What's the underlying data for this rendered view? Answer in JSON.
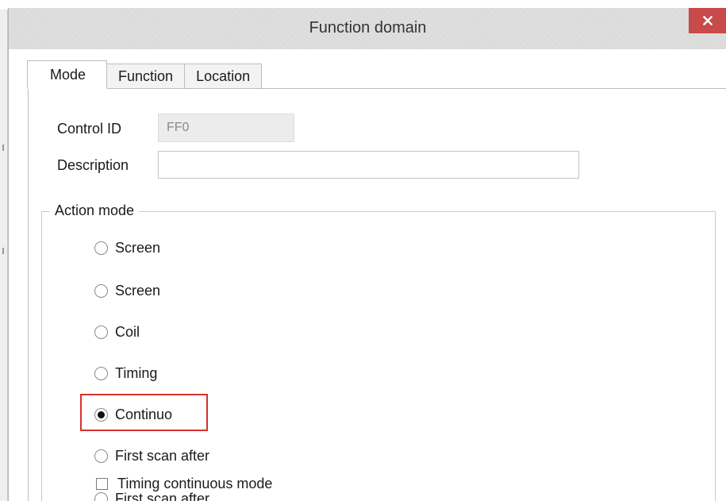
{
  "dialog": {
    "title": "Function domain",
    "close_icon": "close-icon"
  },
  "tabs": [
    {
      "label": "Mode",
      "active": true
    },
    {
      "label": "Function",
      "active": false
    },
    {
      "label": "Location",
      "active": false
    }
  ],
  "form": {
    "control_id_label": "Control ID",
    "control_id_value": "FF0",
    "description_label": "Description",
    "description_value": ""
  },
  "action_mode": {
    "legend": "Action mode",
    "options": [
      {
        "label": "Screen",
        "selected": false
      },
      {
        "label": "Screen",
        "selected": false
      },
      {
        "label": "Coil",
        "selected": false
      },
      {
        "label": "Timing",
        "selected": false
      },
      {
        "label": "Continuo",
        "selected": true
      },
      {
        "label": "First scan after",
        "selected": false
      }
    ],
    "checkbox_label": "Timing continuous mode",
    "last_option_label": "First scan after"
  },
  "colors": {
    "close_button": "#c94a4a",
    "highlight": "#d9302c"
  }
}
